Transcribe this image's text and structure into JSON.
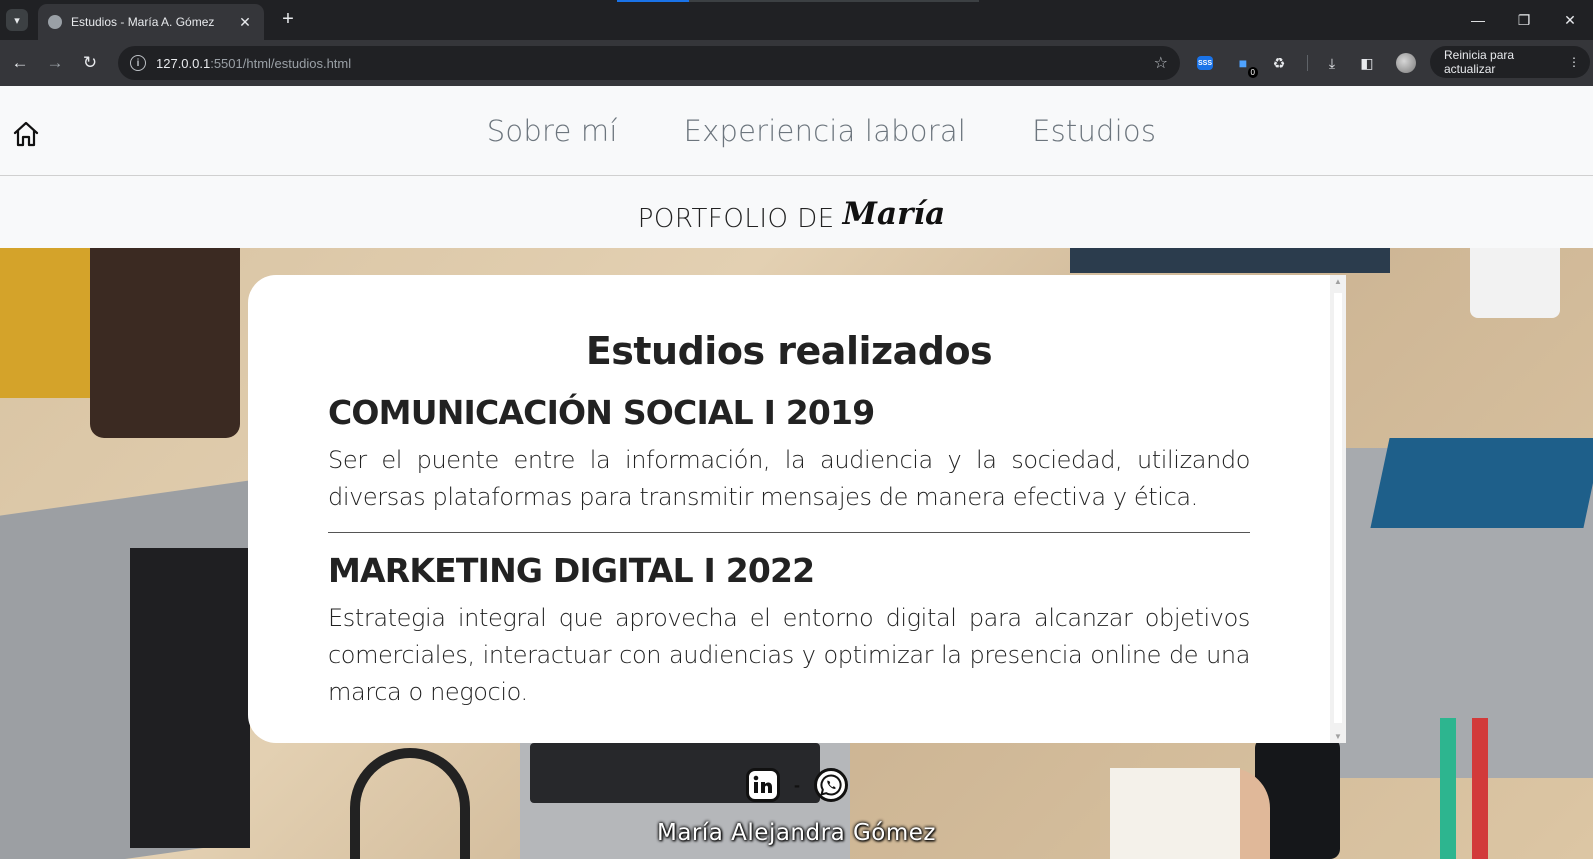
{
  "browser": {
    "tab_title": "Estudios - María A. Gómez",
    "url_host": "127.0.0.1",
    "url_rest": ":5501/html/estudios.html",
    "ext_badge": "0",
    "update_label": "Reinicia para actualizar"
  },
  "nav": {
    "links": [
      "Sobre mí",
      "Experiencia laboral",
      "Estudios"
    ]
  },
  "brand": {
    "prefix": "PORTFOLIO DE",
    "name": "María"
  },
  "studies": {
    "title": "Estudios realizados",
    "items": [
      {
        "title": "COMUNICACIÓN SOCIAL I 2019",
        "description": "Ser el puente entre la información, la audiencia y la sociedad, utilizando diversas plataformas para transmitir mensajes de manera efectiva y ética."
      },
      {
        "title": "MARKETING DIGITAL I 2022",
        "description": "Estrategia integral que aprovecha el entorno digital para alcanzar objetivos comerciales, interactuar con audiencias y optimizar la presencia online de una marca o negocio."
      }
    ]
  },
  "footer": {
    "separator": "-",
    "name": "María Alejandra Gómez"
  },
  "colors": {
    "header_bg": "#f8f9fa",
    "nav_text": "#6c757d",
    "card_bg": "#ffffff",
    "chrome_dark": "#202124",
    "chrome_toolbar": "#35363a"
  }
}
